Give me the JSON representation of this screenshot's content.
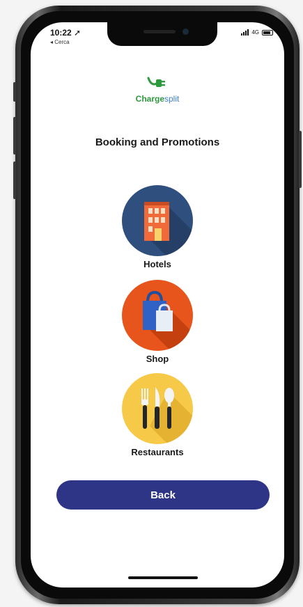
{
  "status_bar": {
    "time": "10:22",
    "back_label": "◂ Cerca",
    "network": "4G"
  },
  "logo": {
    "brand_part1": "Charge",
    "brand_part2": "split"
  },
  "page": {
    "title": "Booking and Promotions"
  },
  "categories": [
    {
      "label": "Hotels",
      "icon": "hotel-building-icon",
      "color": "#2f4f7e"
    },
    {
      "label": "Shop",
      "icon": "shopping-bags-icon",
      "color": "#e7551c"
    },
    {
      "label": "Restaurants",
      "icon": "cutlery-icon",
      "color": "#f7c948"
    }
  ],
  "actions": {
    "back_label": "Back"
  },
  "colors": {
    "accent": "#2e3486",
    "brand_green": "#2e9a3e",
    "brand_blue": "#3a7fd0"
  }
}
